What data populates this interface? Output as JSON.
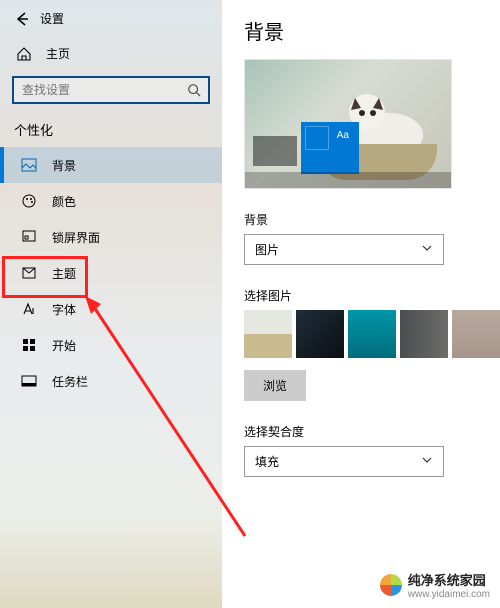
{
  "topbar": {
    "title": "设置"
  },
  "sidebar": {
    "home": "主页",
    "search_placeholder": "查找设置",
    "group": "个性化",
    "items": [
      {
        "label": "背景"
      },
      {
        "label": "颜色"
      },
      {
        "label": "锁屏界面"
      },
      {
        "label": "主题"
      },
      {
        "label": "字体"
      },
      {
        "label": "开始"
      },
      {
        "label": "任务栏"
      }
    ]
  },
  "main": {
    "title": "背景",
    "preview_aa": "Aa",
    "bg_label": "背景",
    "bg_value": "图片",
    "choose_label": "选择图片",
    "browse": "浏览",
    "fit_label": "选择契合度",
    "fit_value": "填充"
  },
  "watermark": {
    "brand": "纯净系统家园",
    "url": "www.yidaimei.com"
  }
}
